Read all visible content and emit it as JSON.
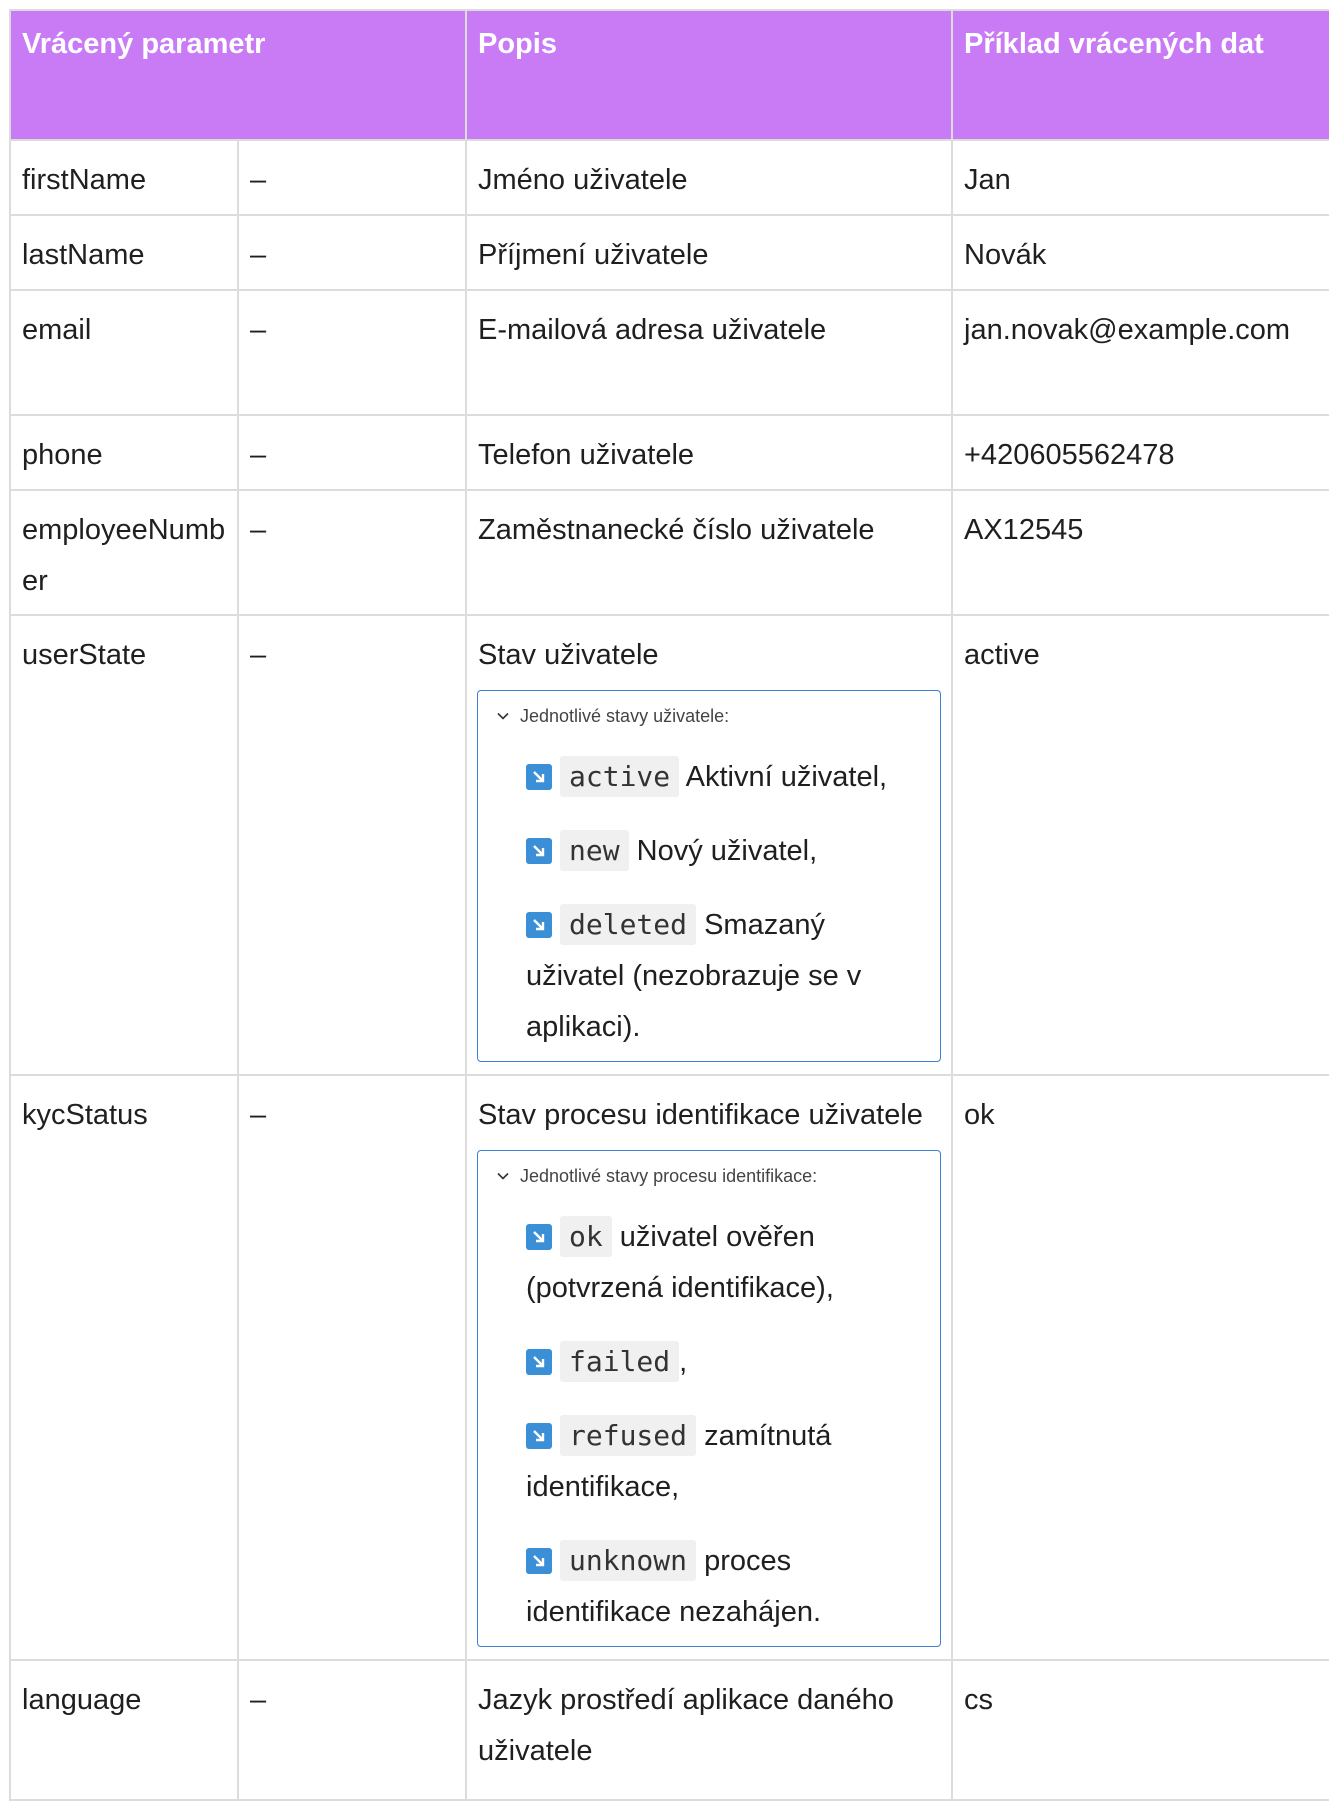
{
  "headers": {
    "param": "Vrácený parametr",
    "description": "Popis",
    "example": "Příklad vrácených dat"
  },
  "rows": [
    {
      "name": "firstName",
      "dash": "–",
      "description": "Jméno uživatele",
      "example": "Jan"
    },
    {
      "name": "lastName",
      "dash": "–",
      "description": "Příjmení uživatele",
      "example": "Novák"
    },
    {
      "name": "email",
      "dash": "–",
      "description": "E-mailová adresa uživatele",
      "example": "jan.novak@example.com"
    },
    {
      "name": "phone",
      "dash": "–",
      "description": "Telefon uživatele",
      "example": "+420605562478"
    },
    {
      "name": "employeeNumber",
      "dash": "–",
      "description": "Zaměstnanecké číslo uživatele",
      "example": "AX12545"
    },
    {
      "name": "userState",
      "dash": "–",
      "description": "Stav uživatele",
      "example": "active",
      "expand": {
        "summary": "Jednotlivé stavy uživatele:",
        "items": [
          {
            "code": "active",
            "text": "Aktivní uživatel,"
          },
          {
            "code": "new",
            "text": "Nový uživatel,"
          },
          {
            "code": "deleted",
            "text": "Smazaný uživatel (nezobrazuje se v aplikaci)."
          }
        ]
      }
    },
    {
      "name": "kycStatus",
      "dash": "–",
      "description": "Stav procesu identifikace uživatele",
      "example": "ok",
      "expand": {
        "summary": "Jednotlivé stavy procesu identifikace:",
        "items": [
          {
            "code": "ok",
            "text": "uživatel ověřen (potvrzená identifikace),"
          },
          {
            "code": "failed",
            "text": ","
          },
          {
            "code": "refused",
            "text": "zamítnutá identifikace,"
          },
          {
            "code": "unknown",
            "text": "proces identifikace nezahájen."
          }
        ]
      }
    },
    {
      "name": "language",
      "dash": "–",
      "description": "Jazyk prostředí aplikace daného uživatele",
      "example": "cs"
    }
  ],
  "icons": {
    "chevron": "chevron-down-icon",
    "item": "arrow-down-right-icon"
  },
  "colors": {
    "header": "#c97af5",
    "expand_border": "#3b82d6",
    "icon": "#3a8fd6"
  }
}
